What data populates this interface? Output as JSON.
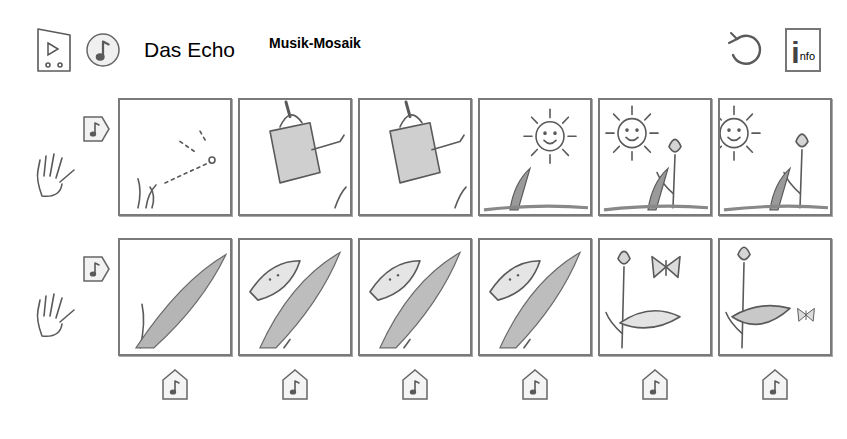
{
  "app": {
    "title": "Das Echo",
    "subtitle": "Musik-Mosaik"
  },
  "toolbar": {
    "info_icon": {
      "mark": "i",
      "rest": "nfo"
    }
  },
  "tracks": [
    {
      "tiles": [
        {
          "kind": "sprout-water"
        },
        {
          "kind": "can"
        },
        {
          "kind": "can"
        },
        {
          "kind": "sun-sprout"
        },
        {
          "kind": "sun-flower"
        },
        {
          "kind": "half-sun-flower"
        }
      ]
    },
    {
      "tiles": [
        {
          "kind": "leaf-grow"
        },
        {
          "kind": "leaf-face"
        },
        {
          "kind": "leaf-face"
        },
        {
          "kind": "leaf-face"
        },
        {
          "kind": "flower-butterfly"
        },
        {
          "kind": "leaf-butterfly"
        }
      ]
    }
  ],
  "column_buttons": [
    {
      "kind": "note"
    },
    {
      "kind": "note"
    },
    {
      "kind": "note"
    },
    {
      "kind": "note"
    },
    {
      "kind": "note"
    },
    {
      "kind": "note"
    }
  ]
}
